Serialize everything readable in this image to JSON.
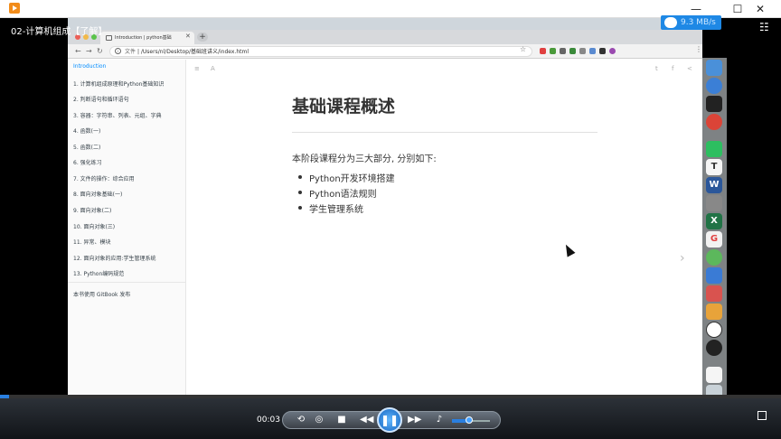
{
  "window": {
    "minimize": "—",
    "maximize": "☐",
    "close": "✕"
  },
  "player": {
    "title": "02-计算机组成【了解】",
    "speed": "9.3 MB/s",
    "time": "00:03",
    "progress": 0.012,
    "volume": 0.45
  },
  "browser": {
    "tab_title": "Introduction | python基础",
    "address_label": "文件",
    "address": "/Users/nl/Desktop/基础班讲义/index.html"
  },
  "sidebar": {
    "items": [
      {
        "label": "Introduction",
        "active": true
      },
      {
        "label": "1. 计算机组成原理和Python基础知识"
      },
      {
        "label": "2. 判断语句和循环语句"
      },
      {
        "label": "3. 容器：字符串、列表、元组、字典"
      },
      {
        "label": "4. 函数(一)"
      },
      {
        "label": "5. 函数(二)"
      },
      {
        "label": "6. 强化练习"
      },
      {
        "label": "7. 文件的操作：综合应用"
      },
      {
        "label": "8. 面向对象基础(一)"
      },
      {
        "label": "9. 面向对象(二)"
      },
      {
        "label": "10. 面向对象(三)"
      },
      {
        "label": "11. 异常、模块"
      },
      {
        "label": "12. 面向对象的应用:学生管理系统"
      },
      {
        "label": "13. Python编码规范"
      }
    ],
    "footer": "本书使用 GitBook 发布"
  },
  "content": {
    "title": "基础课程概述",
    "intro": "本阶段课程分为三大部分, 分别如下:",
    "list": [
      "Python开发环境搭建",
      "Python语法规则",
      "学生管理系统"
    ]
  },
  "colors": {
    "accent": "#008cff",
    "player_blue": "#2a7fe0"
  }
}
